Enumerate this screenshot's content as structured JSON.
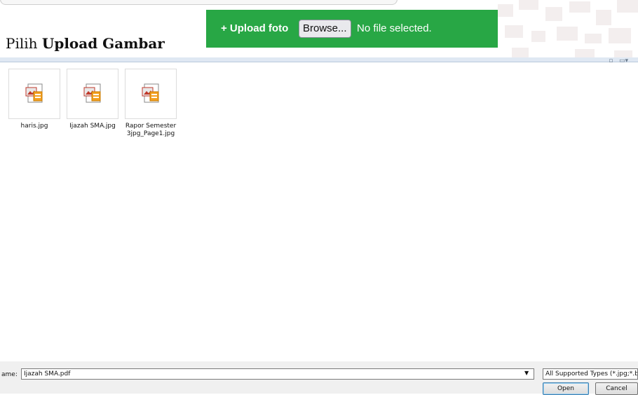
{
  "caption": {
    "prefix": "Pilih ",
    "bold": "Upload Gambar"
  },
  "upload": {
    "label": "+ Upload foto",
    "browse_label": "Browse...",
    "status": "No file selected.",
    "bar_color": "#28a745"
  },
  "files": [
    {
      "name": "haris.jpg",
      "icon": "image-file-icon"
    },
    {
      "name": "Ijazah SMA.jpg",
      "icon": "image-file-icon"
    },
    {
      "name": "Rapor Semester 3jpg_Page1.jpg",
      "icon": "image-file-icon"
    }
  ],
  "bottom": {
    "name_label": "ame:",
    "file_name_value": "Ijazah SMA.pdf",
    "file_type_value": "All Supported Types (*.jpg;*.bm",
    "open_label": "Open",
    "cancel_label": "Cancel"
  }
}
